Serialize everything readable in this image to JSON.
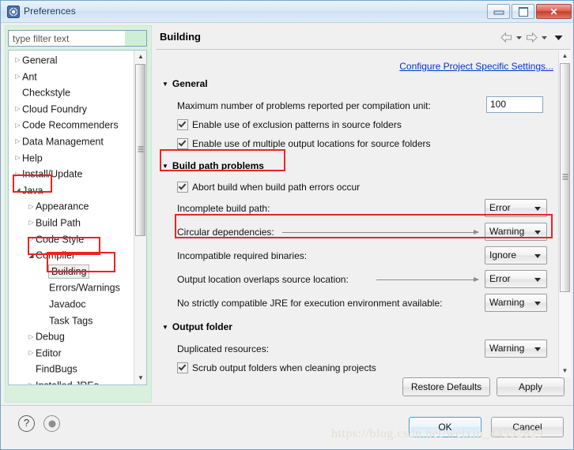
{
  "window": {
    "title": "Preferences",
    "icon": "preferences-gear-icon",
    "minimize_glyph": "",
    "maximize_glyph": "",
    "close_glyph": "✕"
  },
  "sidebar": {
    "filter": {
      "placeholder": "type filter text",
      "value": ""
    },
    "tree": [
      {
        "label": "General",
        "indent": 0,
        "twisty": "collapsed",
        "selected": false,
        "annotated": false
      },
      {
        "label": "Ant",
        "indent": 0,
        "twisty": "collapsed",
        "selected": false,
        "annotated": false
      },
      {
        "label": "Checkstyle",
        "indent": 0,
        "twisty": "none",
        "selected": false,
        "annotated": false
      },
      {
        "label": "Cloud Foundry",
        "indent": 0,
        "twisty": "collapsed",
        "selected": false,
        "annotated": false
      },
      {
        "label": "Code Recommenders",
        "indent": 0,
        "twisty": "collapsed",
        "selected": false,
        "annotated": false
      },
      {
        "label": "Data Management",
        "indent": 0,
        "twisty": "collapsed",
        "selected": false,
        "annotated": false
      },
      {
        "label": "Help",
        "indent": 0,
        "twisty": "collapsed",
        "selected": false,
        "annotated": false
      },
      {
        "label": "Install/Update",
        "indent": 0,
        "twisty": "collapsed",
        "selected": false,
        "annotated": false
      },
      {
        "label": "Java",
        "indent": 0,
        "twisty": "expanded",
        "selected": false,
        "annotated": true
      },
      {
        "label": "Appearance",
        "indent": 1,
        "twisty": "collapsed",
        "selected": false,
        "annotated": false
      },
      {
        "label": "Build Path",
        "indent": 1,
        "twisty": "collapsed",
        "selected": false,
        "annotated": false
      },
      {
        "label": "Code Style",
        "indent": 1,
        "twisty": "collapsed",
        "selected": false,
        "annotated": false
      },
      {
        "label": "Compiler",
        "indent": 1,
        "twisty": "expanded",
        "selected": false,
        "annotated": true
      },
      {
        "label": "Building",
        "indent": 2,
        "twisty": "none",
        "selected": true,
        "annotated": true
      },
      {
        "label": "Errors/Warnings",
        "indent": 2,
        "twisty": "none",
        "selected": false,
        "annotated": false
      },
      {
        "label": "Javadoc",
        "indent": 2,
        "twisty": "none",
        "selected": false,
        "annotated": false
      },
      {
        "label": "Task Tags",
        "indent": 2,
        "twisty": "none",
        "selected": false,
        "annotated": false
      },
      {
        "label": "Debug",
        "indent": 1,
        "twisty": "collapsed",
        "selected": false,
        "annotated": false
      },
      {
        "label": "Editor",
        "indent": 1,
        "twisty": "collapsed",
        "selected": false,
        "annotated": false
      },
      {
        "label": "FindBugs",
        "indent": 1,
        "twisty": "none",
        "selected": false,
        "annotated": false
      },
      {
        "label": "Installed JREs",
        "indent": 1,
        "twisty": "collapsed",
        "selected": false,
        "annotated": false
      }
    ],
    "scroll_up_glyph": "▲",
    "scroll_down_glyph": "▼",
    "scroll_left_glyph": "◀",
    "scroll_right_glyph": "▶"
  },
  "content": {
    "page_title": "Building",
    "nav": {
      "back_icon": "back-arrow-icon",
      "back_menu_icon": "chevron-down-icon",
      "forward_icon": "forward-arrow-icon",
      "forward_menu_icon": "chevron-down-icon",
      "view_menu_icon": "chevron-down-icon"
    },
    "configure_link": "Configure Project Specific Settings...",
    "sections": {
      "general": {
        "title": "General",
        "max_problems_label": "Maximum number of problems reported per compilation unit:",
        "max_problems_value": "100",
        "checkbox_exclusion": "Enable use of exclusion patterns in source folders",
        "checkbox_multiple_output": "Enable use of multiple output locations for source folders"
      },
      "build_path_problems": {
        "title": "Build path problems",
        "checkbox_abort": "Abort build when build path errors occur",
        "rows": [
          {
            "label": "Incomplete build path:",
            "value": "Error"
          },
          {
            "label": "Circular dependencies:",
            "value": "Warning"
          },
          {
            "label": "Incompatible required binaries:",
            "value": "Ignore"
          },
          {
            "label": "Output location overlaps source location:",
            "value": "Error"
          },
          {
            "label": "No strictly compatible JRE for execution environment available:",
            "value": "Warning"
          }
        ]
      },
      "output_folder": {
        "title": "Output folder",
        "rows": [
          {
            "label": "Duplicated resources:",
            "value": "Warning"
          }
        ],
        "checkbox_scrub": "Scrub output folders when cleaning projects"
      }
    },
    "restore_defaults_label": "Restore Defaults",
    "apply_label": "Apply",
    "scroll_up_glyph": "▲",
    "scroll_down_glyph": "▼"
  },
  "footer": {
    "help_glyph": "?",
    "record_icon": "record-circle-icon",
    "ok_label": "OK",
    "cancel_label": "Cancel",
    "watermark": "https://blog.csdn.net/weixin_44552829"
  },
  "colors": {
    "accent_blue": "#3c9ad4",
    "link_blue": "#0033cc",
    "annotation_red": "#ee2222",
    "tree_panel_green": "#d9f0dd"
  }
}
